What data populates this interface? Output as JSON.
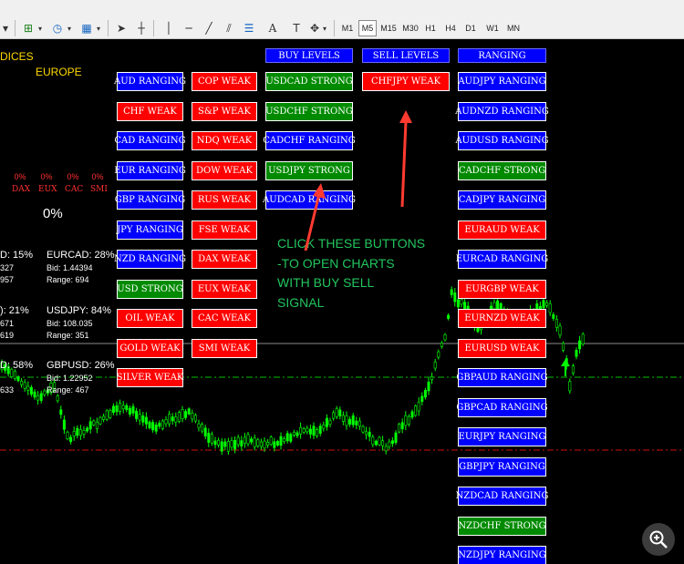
{
  "toolbar": {
    "timeframes": [
      "M1",
      "M5",
      "M15",
      "M30",
      "H1",
      "H4",
      "D1",
      "W1",
      "MN"
    ],
    "active_timeframe": "M5"
  },
  "chart_labels": {
    "indices_partial": "DICES",
    "europe": "EUROPE",
    "index_pcts": [
      "0%",
      "0%",
      "0%",
      "0%"
    ],
    "index_names": [
      "DAX",
      "EUX",
      "CAC",
      "SMI"
    ],
    "total_pct": "0%"
  },
  "pairs": {
    "left": [
      {
        "sym": "D: 15%",
        "bid": "327",
        "range": "957"
      },
      {
        "sym": "): 21%",
        "bid": "671",
        "range": "619"
      },
      {
        "sym": "D: 58%",
        "bid": "",
        "range": "633"
      }
    ],
    "right": [
      {
        "sym": "EURCAD: 28%",
        "bid": "Bid: 1.44394",
        "range": "Range: 694"
      },
      {
        "sym": "USDJPY: 84%",
        "bid": "Bid: 108.035",
        "range": "Range: 351"
      },
      {
        "sym": "GBPUSD: 26%",
        "bid": "Bid: 1.22952",
        "range": "Range: 467"
      }
    ]
  },
  "currency_buttons": [
    {
      "label": "AUD RANGING",
      "color": "blue"
    },
    {
      "label": "CHF WEAK",
      "color": "red"
    },
    {
      "label": "CAD RANGING",
      "color": "blue"
    },
    {
      "label": "EUR RANGING",
      "color": "blue"
    },
    {
      "label": "GBP RANGING",
      "color": "blue"
    },
    {
      "label": "JPY RANGING",
      "color": "blue"
    },
    {
      "label": "NZD RANGING",
      "color": "blue"
    },
    {
      "label": "USD STRONG",
      "color": "green"
    },
    {
      "label": "OIL WEAK",
      "color": "red"
    },
    {
      "label": "GOLD WEAK",
      "color": "red"
    },
    {
      "label": "SILVER WEAK",
      "color": "red"
    }
  ],
  "index_buttons": [
    {
      "label": "COP WEAK",
      "color": "red"
    },
    {
      "label": "S&P WEAK",
      "color": "red"
    },
    {
      "label": "NDQ WEAK",
      "color": "red"
    },
    {
      "label": "DOW WEAK",
      "color": "red"
    },
    {
      "label": "RUS WEAK",
      "color": "red"
    },
    {
      "label": "FSE WEAK",
      "color": "red"
    },
    {
      "label": "DAX WEAK",
      "color": "red"
    },
    {
      "label": "EUX WEAK",
      "color": "red"
    },
    {
      "label": "CAC WEAK",
      "color": "red"
    },
    {
      "label": "SMI WEAK",
      "color": "red"
    }
  ],
  "buy_levels": {
    "header": "BUY LEVELS",
    "buttons": [
      {
        "label": "USDCAD STRONG",
        "color": "green"
      },
      {
        "label": "USDCHF STRONG",
        "color": "green"
      },
      {
        "label": "CADCHF RANGING",
        "color": "blue"
      },
      {
        "label": "USDJPY STRONG",
        "color": "green"
      },
      {
        "label": "AUDCAD RANGING",
        "color": "blue"
      }
    ]
  },
  "sell_levels": {
    "header": "SELL LEVELS",
    "buttons": [
      {
        "label": "CHFJPY WEAK",
        "color": "red"
      }
    ]
  },
  "ranging": {
    "header": "RANGING",
    "buttons": [
      {
        "label": "AUDJPY RANGING",
        "color": "blue"
      },
      {
        "label": "AUDNZD RANGING",
        "color": "blue"
      },
      {
        "label": "AUDUSD RANGING",
        "color": "blue"
      },
      {
        "label": "CADCHF STRONG",
        "color": "green"
      },
      {
        "label": "CADJPY RANGING",
        "color": "blue"
      },
      {
        "label": "EURAUD WEAK",
        "color": "red"
      },
      {
        "label": "EURCAD RANGING",
        "color": "blue"
      },
      {
        "label": "EURGBP WEAK",
        "color": "red"
      },
      {
        "label": "EURNZD WEAK",
        "color": "red"
      },
      {
        "label": "EURUSD WEAK",
        "color": "red"
      },
      {
        "label": "GBPAUD RANGING",
        "color": "blue"
      },
      {
        "label": "GBPCAD RANGING",
        "color": "blue"
      },
      {
        "label": "EURJPY RANGING",
        "color": "blue"
      },
      {
        "label": "GBPJPY RANGING",
        "color": "blue"
      },
      {
        "label": "NZDCAD RANGING",
        "color": "blue"
      },
      {
        "label": "NZDCHF STRONG",
        "color": "green"
      },
      {
        "label": "NZDJPY RANGING",
        "color": "blue"
      }
    ]
  },
  "annotation": {
    "lines": [
      "CLICK THESE BUTTONS",
      "-TO OPEN CHARTS",
      "WITH BUY SELL",
      "SIGNAL"
    ],
    "color": "#22c55e"
  },
  "colors": {
    "candle": "#00ff00",
    "arrow": "#ff3b30",
    "buy_line": "#00c000",
    "sell_line": "#d01010"
  },
  "icons": [
    "new-chart-icon",
    "clock-icon",
    "template-icon",
    "cursor-icon",
    "crosshair-icon",
    "vertical-line-icon",
    "horizontal-line-icon",
    "trendline-icon",
    "channel-icon",
    "fibonacci-icon",
    "text-icon",
    "shapes-icon",
    "zoom-in-icon"
  ]
}
